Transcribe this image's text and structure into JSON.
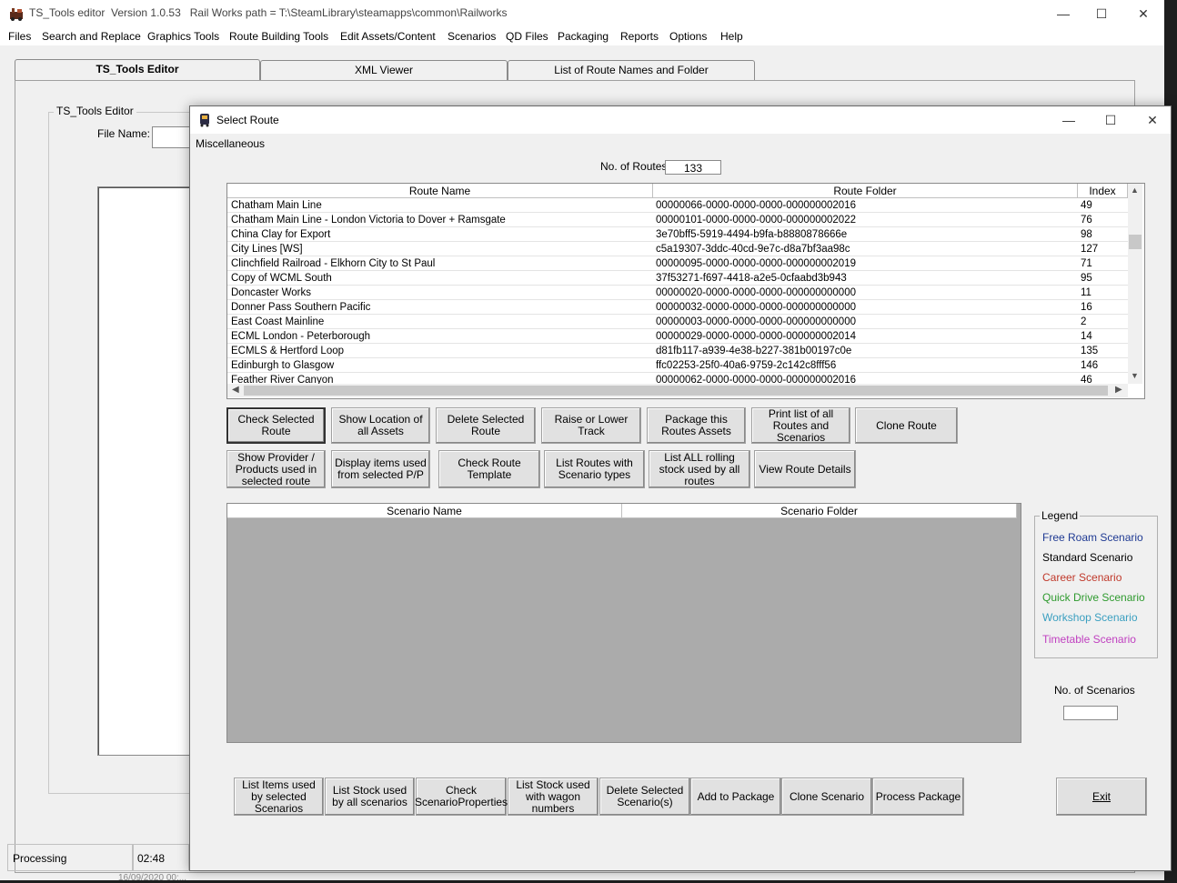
{
  "app": {
    "title": "TS_Tools editor  Version 1.0.53   Rail Works path = T:\\SteamLibrary\\steamapps\\common\\Railworks",
    "minimize": "—",
    "maximize": "☐",
    "close": "✕"
  },
  "menu": [
    "Files",
    "Search and Replace",
    "Graphics Tools",
    "Route Building Tools",
    "Edit Assets/Content",
    "Scenarios",
    "QD Files",
    "Packaging",
    "Reports",
    "Options",
    "Help"
  ],
  "tabs": [
    "TS_Tools Editor",
    "XML Viewer",
    "List of Route Names and Folder"
  ],
  "editor": {
    "group_title": "TS_Tools Editor",
    "file_name_label": "File Name:"
  },
  "status": {
    "left": "Processing",
    "time": "02:48",
    "bottom_partial": "16/09/2020 00:..."
  },
  "dialog": {
    "title": "Select Route",
    "menu": "Miscellaneous",
    "routes_count_label": "No. of Routes",
    "routes_count": "133",
    "columns": [
      "Route Name",
      "Route Folder",
      "Index"
    ],
    "rows": [
      {
        "name": "Chatham Main Line",
        "folder": "00000066-0000-0000-0000-000000002016",
        "index": "49"
      },
      {
        "name": "Chatham Main Line - London Victoria to Dover + Ramsgate",
        "folder": "00000101-0000-0000-0000-000000002022",
        "index": "76"
      },
      {
        "name": "China Clay for Export",
        "folder": "3e70bff5-5919-4494-b9fa-b8880878666e",
        "index": "98"
      },
      {
        "name": "City Lines [WS]",
        "folder": "c5a19307-3ddc-40cd-9e7c-d8a7bf3aa98c",
        "index": "127"
      },
      {
        "name": "Clinchfield Railroad - Elkhorn City to St Paul",
        "folder": "00000095-0000-0000-0000-000000002019",
        "index": "71"
      },
      {
        "name": "Copy of WCML South",
        "folder": "37f53271-f697-4418-a2e5-0cfaabd3b943",
        "index": "95"
      },
      {
        "name": "Doncaster Works",
        "folder": "00000020-0000-0000-0000-000000000000",
        "index": "11"
      },
      {
        "name": "Donner Pass Southern Pacific",
        "folder": "00000032-0000-0000-0000-000000000000",
        "index": "16"
      },
      {
        "name": "East Coast Mainline",
        "folder": "00000003-0000-0000-0000-000000000000",
        "index": "2"
      },
      {
        "name": "ECML London - Peterborough",
        "folder": "00000029-0000-0000-0000-000000002014",
        "index": "14"
      },
      {
        "name": "ECMLS & Hertford Loop",
        "folder": "d81fb117-a939-4e38-b227-381b00197c0e",
        "index": "135"
      },
      {
        "name": "Edinburgh to Glasgow",
        "folder": "ffc02253-25f0-40a6-9759-2c142c8fff56",
        "index": "146"
      },
      {
        "name": "Feather River Canyon",
        "folder": "00000062-0000-0000-0000-000000002016",
        "index": "46"
      }
    ],
    "buttons_row1": [
      "Check Selected Route",
      "Show Location of all Assets",
      "Delete Selected Route",
      "Raise or Lower Track",
      "Package this Routes Assets",
      "Print list of all Routes and Scenarios",
      "Clone Route"
    ],
    "buttons_row2": [
      "Show Provider / Products used in selected route",
      "Display items used from selected P/P",
      "Check Route Template",
      "List Routes with Scenario types",
      "List ALL rolling stock used by all routes",
      "View Route Details"
    ],
    "scenario_columns": [
      "Scenario Name",
      "Scenario Folder"
    ],
    "legend": {
      "title": "Legend",
      "items": [
        {
          "label": "Free Roam Scenario",
          "color": "#1f3a93"
        },
        {
          "label": "Standard Scenario",
          "color": "#000000"
        },
        {
          "label": "Career Scenario",
          "color": "#c0392b"
        },
        {
          "label": "Quick Drive Scenario",
          "color": "#2e9a2e"
        },
        {
          "label": "Workshop Scenario",
          "color": "#3a9fc0"
        },
        {
          "label": "Timetable Scenario",
          "color": "#c040c0"
        }
      ]
    },
    "scenarios_count_label": "No. of Scenarios",
    "scenarios_count": "",
    "buttons_bottom": [
      "List Items used by selected Scenarios",
      "List Stock used by all scenarios",
      "Check ScenarioProperties",
      "List Stock used with wagon numbers",
      "Delete Selected Scenario(s)",
      "Add to Package",
      "Clone Scenario",
      "Process Package"
    ],
    "exit": "Exit"
  }
}
